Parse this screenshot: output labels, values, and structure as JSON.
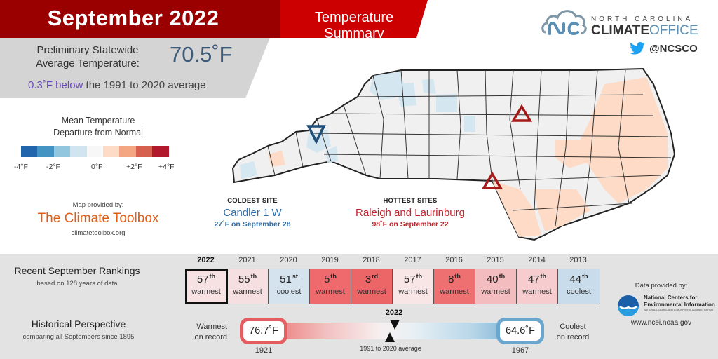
{
  "header": {
    "title": "September 2022",
    "subtitle": "Temperature Summary"
  },
  "average": {
    "label_line1": "Preliminary Statewide",
    "label_line2": "Average Temperature:",
    "value": "70.5˚F",
    "departure_highlight": "0.3˚F below",
    "departure_rest": " the 1991 to 2020 average"
  },
  "legend": {
    "title_line1": "Mean Temperature",
    "title_line2": "Departure from Normal",
    "colors": [
      "#2166ac",
      "#4393c3",
      "#92c5de",
      "#d1e5f0",
      "#f7f7f7",
      "#fddbc7",
      "#f4a582",
      "#d6604d",
      "#b2182b"
    ],
    "ticks": [
      "-4°F",
      "-2°F",
      "0°F",
      "+2°F",
      "+4°F"
    ]
  },
  "map_credit": {
    "label": "Map provided by:",
    "name": "The Climate Toolbox",
    "url": "climatetoolbox.org"
  },
  "logo": {
    "top": "NORTH CAROLINA",
    "bold": "CLIMATE",
    "light": "OFFICE",
    "twitter": "@NCSCO"
  },
  "coldest": {
    "heading": "COLDEST SITE",
    "name": "Candler 1 W",
    "detail": "27˚F on September 28",
    "color": "#2f6da8"
  },
  "hottest": {
    "heading": "HOTTEST SITES",
    "name": "Raleigh and Laurinburg",
    "detail": "98˚F on September 22",
    "color": "#c0232b"
  },
  "rankings": {
    "title": "Recent September Rankings",
    "subtitle": "based on 128 years of data",
    "items": [
      {
        "year": "2022",
        "rank": "57",
        "suffix": "th",
        "label": "warmest",
        "color": "#f6e1e3",
        "current": true
      },
      {
        "year": "2021",
        "rank": "55",
        "suffix": "th",
        "label": "warmest",
        "color": "#f6dfe1"
      },
      {
        "year": "2020",
        "rank": "51",
        "suffix": "st",
        "label": "coolest",
        "color": "#d4e3ed"
      },
      {
        "year": "2019",
        "rank": "5",
        "suffix": "th",
        "label": "warmest",
        "color": "#ee6a6c"
      },
      {
        "year": "2018",
        "rank": "3",
        "suffix": "rd",
        "label": "warmest",
        "color": "#ec6567"
      },
      {
        "year": "2017",
        "rank": "57",
        "suffix": "th",
        "label": "warmest",
        "color": "#f8e6e7"
      },
      {
        "year": "2016",
        "rank": "8",
        "suffix": "th",
        "label": "warmest",
        "color": "#ee7071"
      },
      {
        "year": "2015",
        "rank": "40",
        "suffix": "th",
        "label": "warmest",
        "color": "#f3bcbe"
      },
      {
        "year": "2014",
        "rank": "47",
        "suffix": "th",
        "label": "warmest",
        "color": "#f6ccce"
      },
      {
        "year": "2013",
        "rank": "44",
        "suffix": "th",
        "label": "coolest",
        "color": "#c8dceb"
      }
    ]
  },
  "historical": {
    "title": "Historical Perspective",
    "subtitle": "comparing all Septembers since 1895",
    "warmest_label_1": "Warmest",
    "warmest_label_2": "on record",
    "warmest_value": "76.7˚F",
    "warmest_year": "1921",
    "coolest_label_1": "Coolest",
    "coolest_label_2": "on record",
    "coolest_value": "64.6˚F",
    "coolest_year": "1967",
    "current_year": "2022",
    "average_label": "1991 to 2020 average"
  },
  "data_credit": {
    "label": "Data provided by:",
    "org_line1": "National Centers for",
    "org_line2": "Environmental Information",
    "org_line3": "NATIONAL OCEANIC AND ATMOSPHERIC ADMINISTRATION",
    "url": "www.ncei.noaa.gov"
  }
}
